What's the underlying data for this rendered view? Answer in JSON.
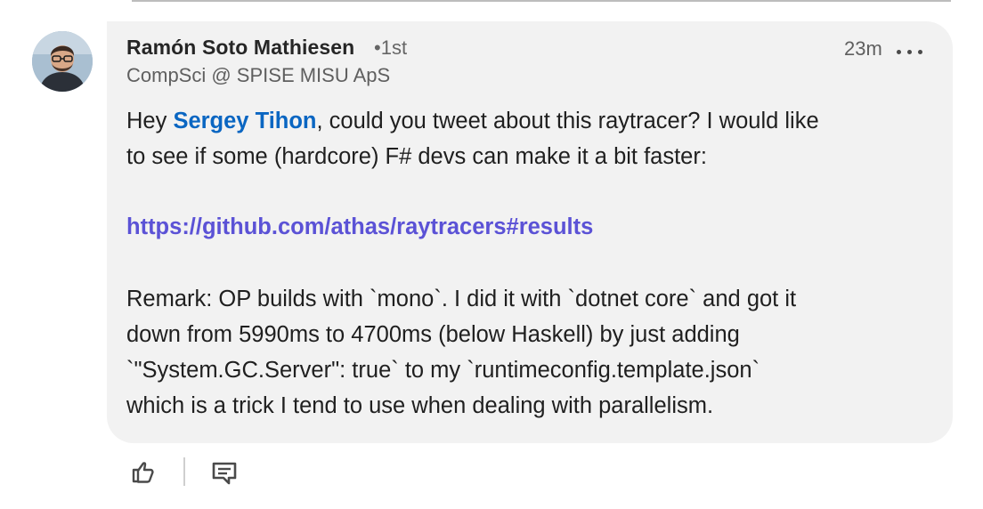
{
  "comment": {
    "author": {
      "name": "Ramón Soto Mathiesen",
      "degree": "•1st",
      "headline": "CompSci @ SPISE MISU ApS",
      "avatar_icon": "profile-photo"
    },
    "timestamp": "23m",
    "more_icon": "ellipsis-icon",
    "body": {
      "line1_prefix": "Hey ",
      "mention": "Sergey Tihon",
      "line1_suffix": ", could you tweet about this raytracer? I would like",
      "line2": "to see if some (hardcore) F# devs can make it a bit faster:",
      "link": "https://github.com/athas/raytracers#results",
      "line4": "Remark: OP builds with `mono`. I did it with `dotnet core` and got it",
      "line5": "down from 5990ms to 4700ms (below Haskell) by just adding",
      "line6": "`\"System.GC.Server\": true` to my `runtimeconfig.template.json`",
      "line7": "which is a trick I tend to use when dealing with parallelism."
    },
    "colors": {
      "mention": "#0a66c2",
      "link": "#5b52d6",
      "bubble": "#f2f2f2"
    }
  },
  "actions": {
    "like_icon": "thumbs-up-icon",
    "reply_icon": "comment-icon"
  }
}
